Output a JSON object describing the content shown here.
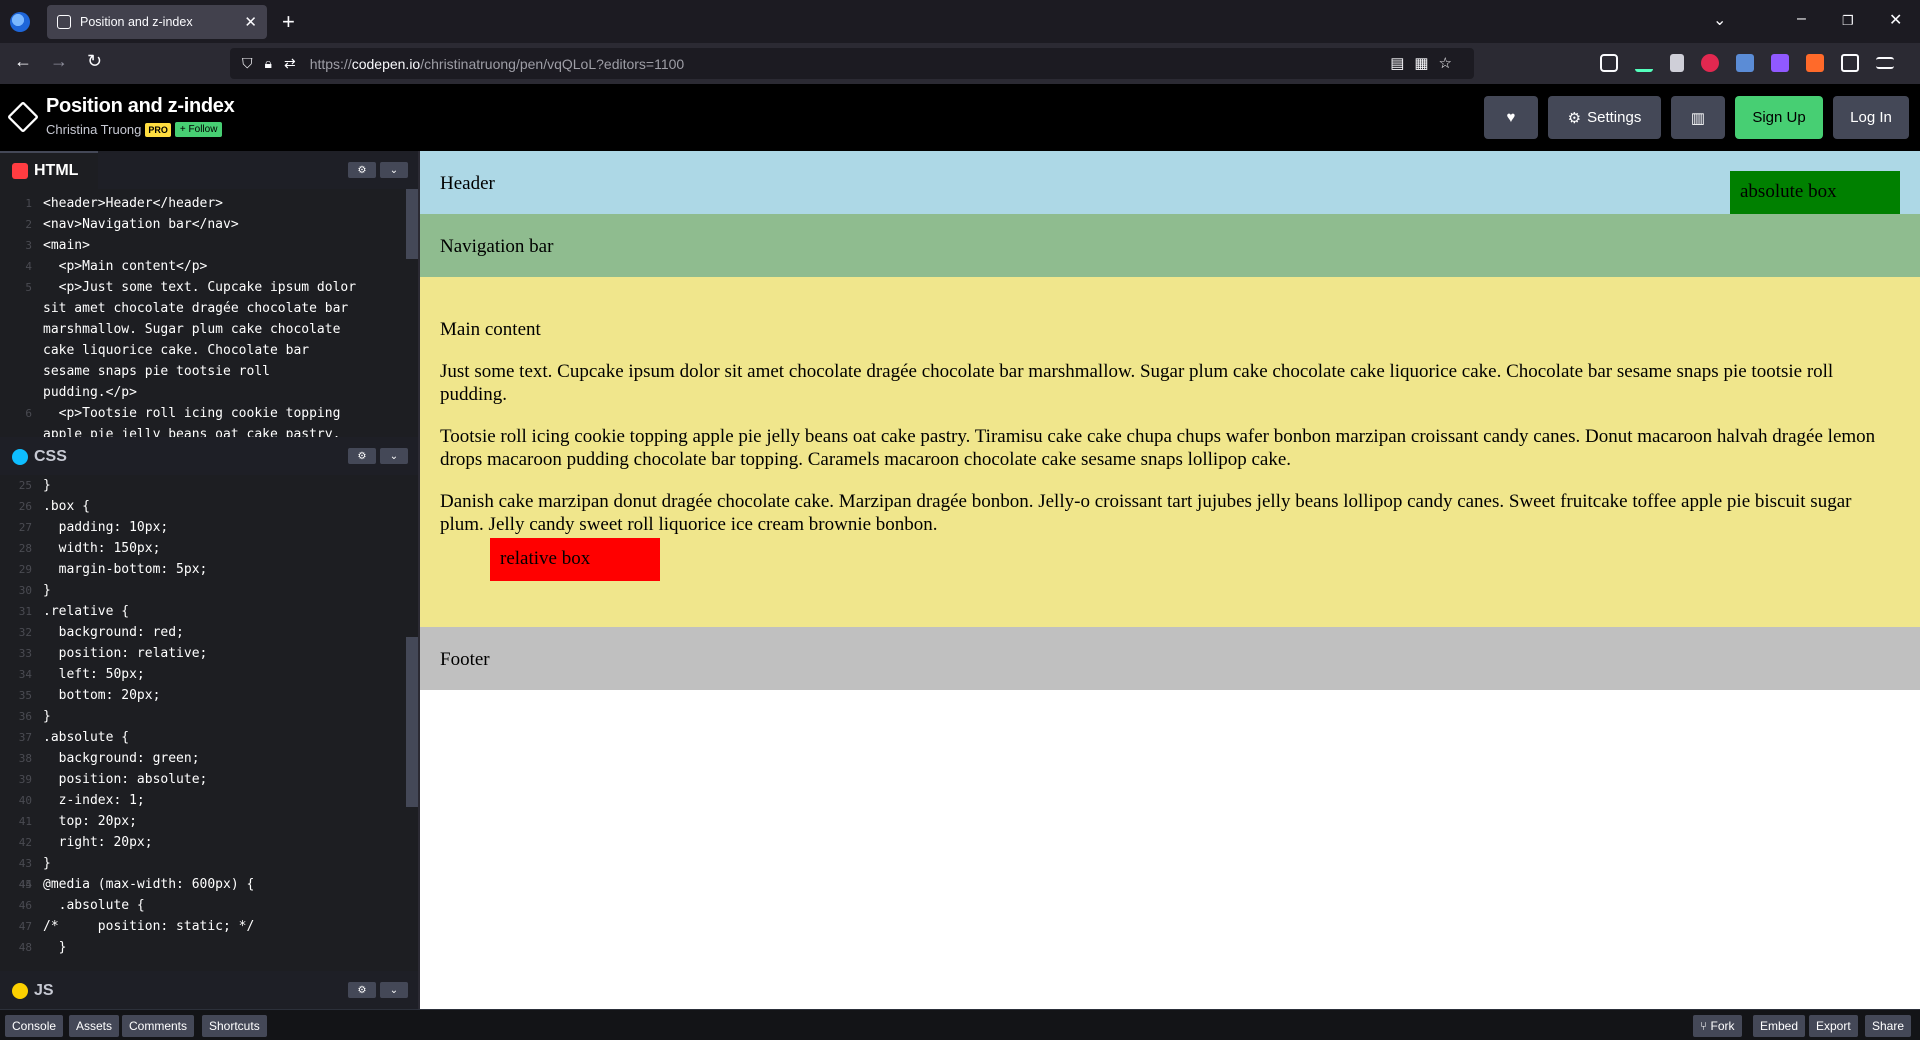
{
  "browser": {
    "tab_title": "Position and z-index",
    "url_prefix": "https://",
    "url_host": "codepen.io",
    "url_path": "/christinatruong/pen/vqQLoL?editors=1100"
  },
  "codepen": {
    "title": "Position and z-index",
    "author": "Christina Truong",
    "pro_badge": "PRO",
    "follow_label": "+ Follow",
    "settings_label": "Settings",
    "signup_label": "Sign Up",
    "login_label": "Log In"
  },
  "editors": {
    "html_label": "HTML",
    "css_label": "CSS",
    "js_label": "JS",
    "html_lines": [
      {
        "n": "1",
        "code": "<header>Header</header>"
      },
      {
        "n": "2",
        "code": "<nav>Navigation bar</nav>"
      },
      {
        "n": "3",
        "code": "<main>"
      },
      {
        "n": "4",
        "code": "  <p>Main content</p>"
      },
      {
        "n": "5",
        "code": "  <p>Just some text. Cupcake ipsum dolor"
      },
      {
        "n": "",
        "code": "sit amet chocolate dragée chocolate bar"
      },
      {
        "n": "",
        "code": "marshmallow. Sugar plum cake chocolate"
      },
      {
        "n": "",
        "code": "cake liquorice cake. Chocolate bar"
      },
      {
        "n": "",
        "code": "sesame snaps pie tootsie roll"
      },
      {
        "n": "",
        "code": "pudding.</p>"
      },
      {
        "n": "6",
        "code": "  <p>Tootsie roll icing cookie topping"
      },
      {
        "n": "",
        "code": "apple pie jelly beans oat cake pastry."
      }
    ],
    "css_lines": [
      {
        "n": "25",
        "code": "}"
      },
      {
        "n": "26",
        "code": ".box {"
      },
      {
        "n": "27",
        "code": "  padding: 10px;"
      },
      {
        "n": "28",
        "code": "  width: 150px;"
      },
      {
        "n": "29",
        "code": "  margin-bottom: 5px;"
      },
      {
        "n": "30",
        "code": "}"
      },
      {
        "n": "31",
        "code": ".relative {"
      },
      {
        "n": "32",
        "code": "  background: red;"
      },
      {
        "n": "33",
        "code": "  position: relative;"
      },
      {
        "n": "34",
        "code": "  left: 50px;"
      },
      {
        "n": "35",
        "code": "  bottom: 20px;"
      },
      {
        "n": "36",
        "code": "}"
      },
      {
        "n": "37",
        "code": ".absolute {"
      },
      {
        "n": "38",
        "code": "  background: green;"
      },
      {
        "n": "39",
        "code": "  position: absolute;"
      },
      {
        "n": "40",
        "code": "  z-index: 1;"
      },
      {
        "n": "41",
        "code": "  top: 20px;"
      },
      {
        "n": "42",
        "code": "  right: 20px;"
      },
      {
        "n": "43",
        "code": "}"
      },
      {
        "n": "44",
        "code": ""
      },
      {
        "n": "45",
        "code": "@media (max-width: 600px) {"
      },
      {
        "n": "46",
        "code": "  .absolute {"
      },
      {
        "n": "47",
        "code": "/*     position: static; */"
      },
      {
        "n": "48",
        "code": "  }"
      }
    ]
  },
  "preview": {
    "header": "Header",
    "nav": "Navigation bar",
    "main_title": "Main content",
    "p1": "Just some text. Cupcake ipsum dolor sit amet chocolate dragée chocolate bar marshmallow. Sugar plum cake chocolate cake liquorice cake. Chocolate bar sesame snaps pie tootsie roll pudding.",
    "p2": "Tootsie roll icing cookie topping apple pie jelly beans oat cake pastry. Tiramisu cake cake chupa chups wafer bonbon marzipan croissant candy canes. Donut macaroon halvah dragée lemon drops macaroon pudding chocolate bar topping. Caramels macaroon chocolate cake sesame snaps lollipop cake.",
    "p3": "Danish cake marzipan donut dragée chocolate cake. Marzipan dragée bonbon. Jelly-o croissant tart jujubes jelly beans lollipop candy canes. Sweet fruitcake toffee apple pie biscuit sugar plum. Jelly candy sweet roll liquorice ice cream brownie bonbon.",
    "relative_box": "relative box",
    "absolute_box": "absolute box",
    "footer": "Footer"
  },
  "bottombar": {
    "console": "Console",
    "assets": "Assets",
    "comments": "Comments",
    "shortcuts": "Shortcuts",
    "fork": "Fork",
    "embed": "Embed",
    "export": "Export",
    "share": "Share"
  }
}
